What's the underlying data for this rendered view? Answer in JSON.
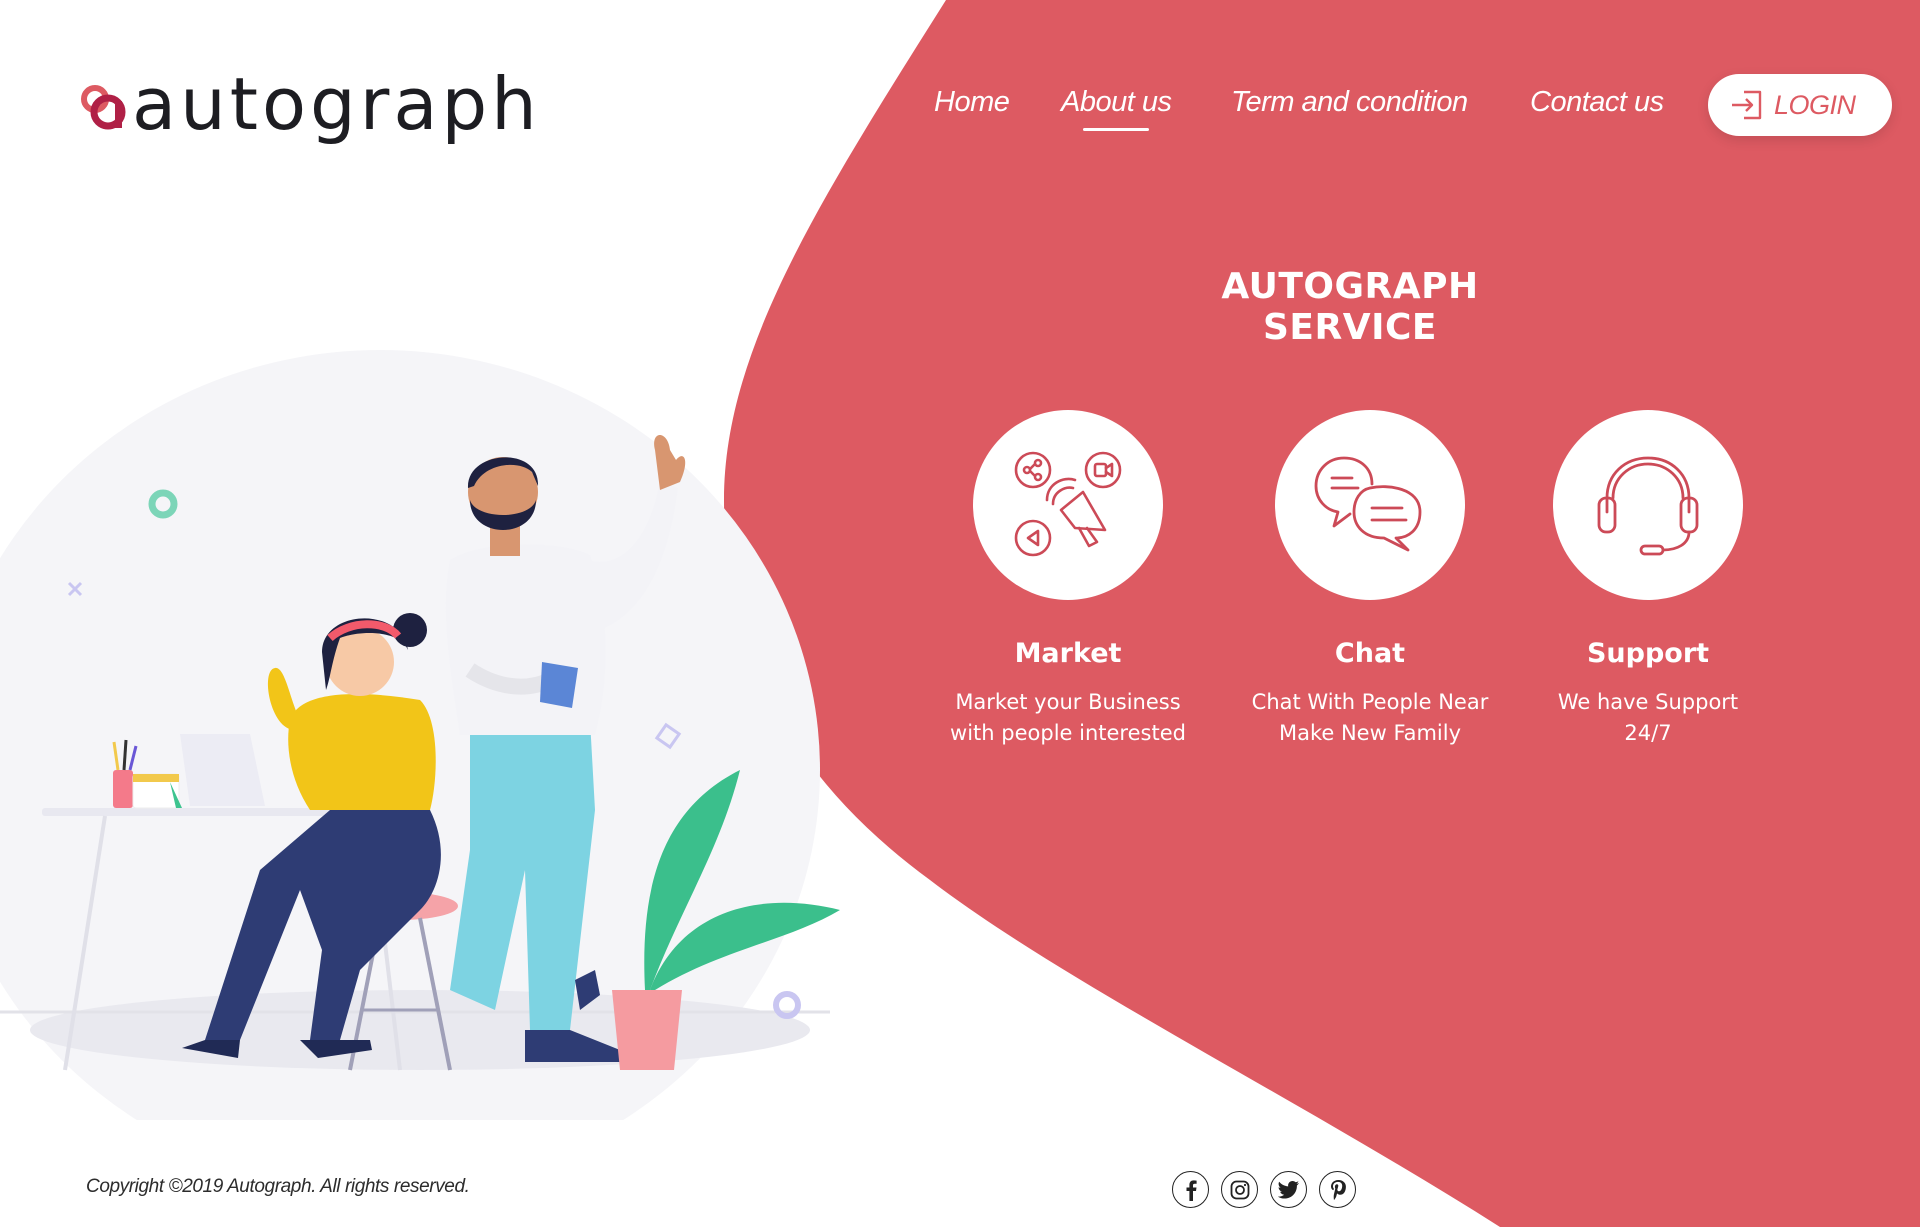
{
  "brand": {
    "name": "autograph",
    "accent_color": "#dd5a62",
    "logo_mark_colors": [
      "#dd5a62",
      "#b02046"
    ]
  },
  "nav": {
    "items": [
      {
        "label": "Home"
      },
      {
        "label": "About us",
        "active": true
      },
      {
        "label": "Term and condition"
      },
      {
        "label": "Contact us"
      }
    ],
    "login": {
      "label": "LOGIN",
      "icon": "login-arrow-icon"
    }
  },
  "service": {
    "title": "AUTOGRAPH SERVICE",
    "cards": [
      {
        "name": "Market",
        "desc_line1": "Market your Business",
        "desc_line2": "with people interested",
        "icon": "megaphone-icon"
      },
      {
        "name": "Chat",
        "desc_line1": "Chat With People Near",
        "desc_line2": "Make New Family",
        "icon": "chat-bubbles-icon"
      },
      {
        "name": "Support",
        "desc_line1": "We have Support",
        "desc_line2": "24/7",
        "icon": "headset-icon"
      }
    ]
  },
  "footer": {
    "copyright": "Copyright ©2019 Autograph. All rights reserved.",
    "social": [
      "facebook-icon",
      "instagram-icon",
      "twitter-icon",
      "pinterest-icon"
    ]
  }
}
